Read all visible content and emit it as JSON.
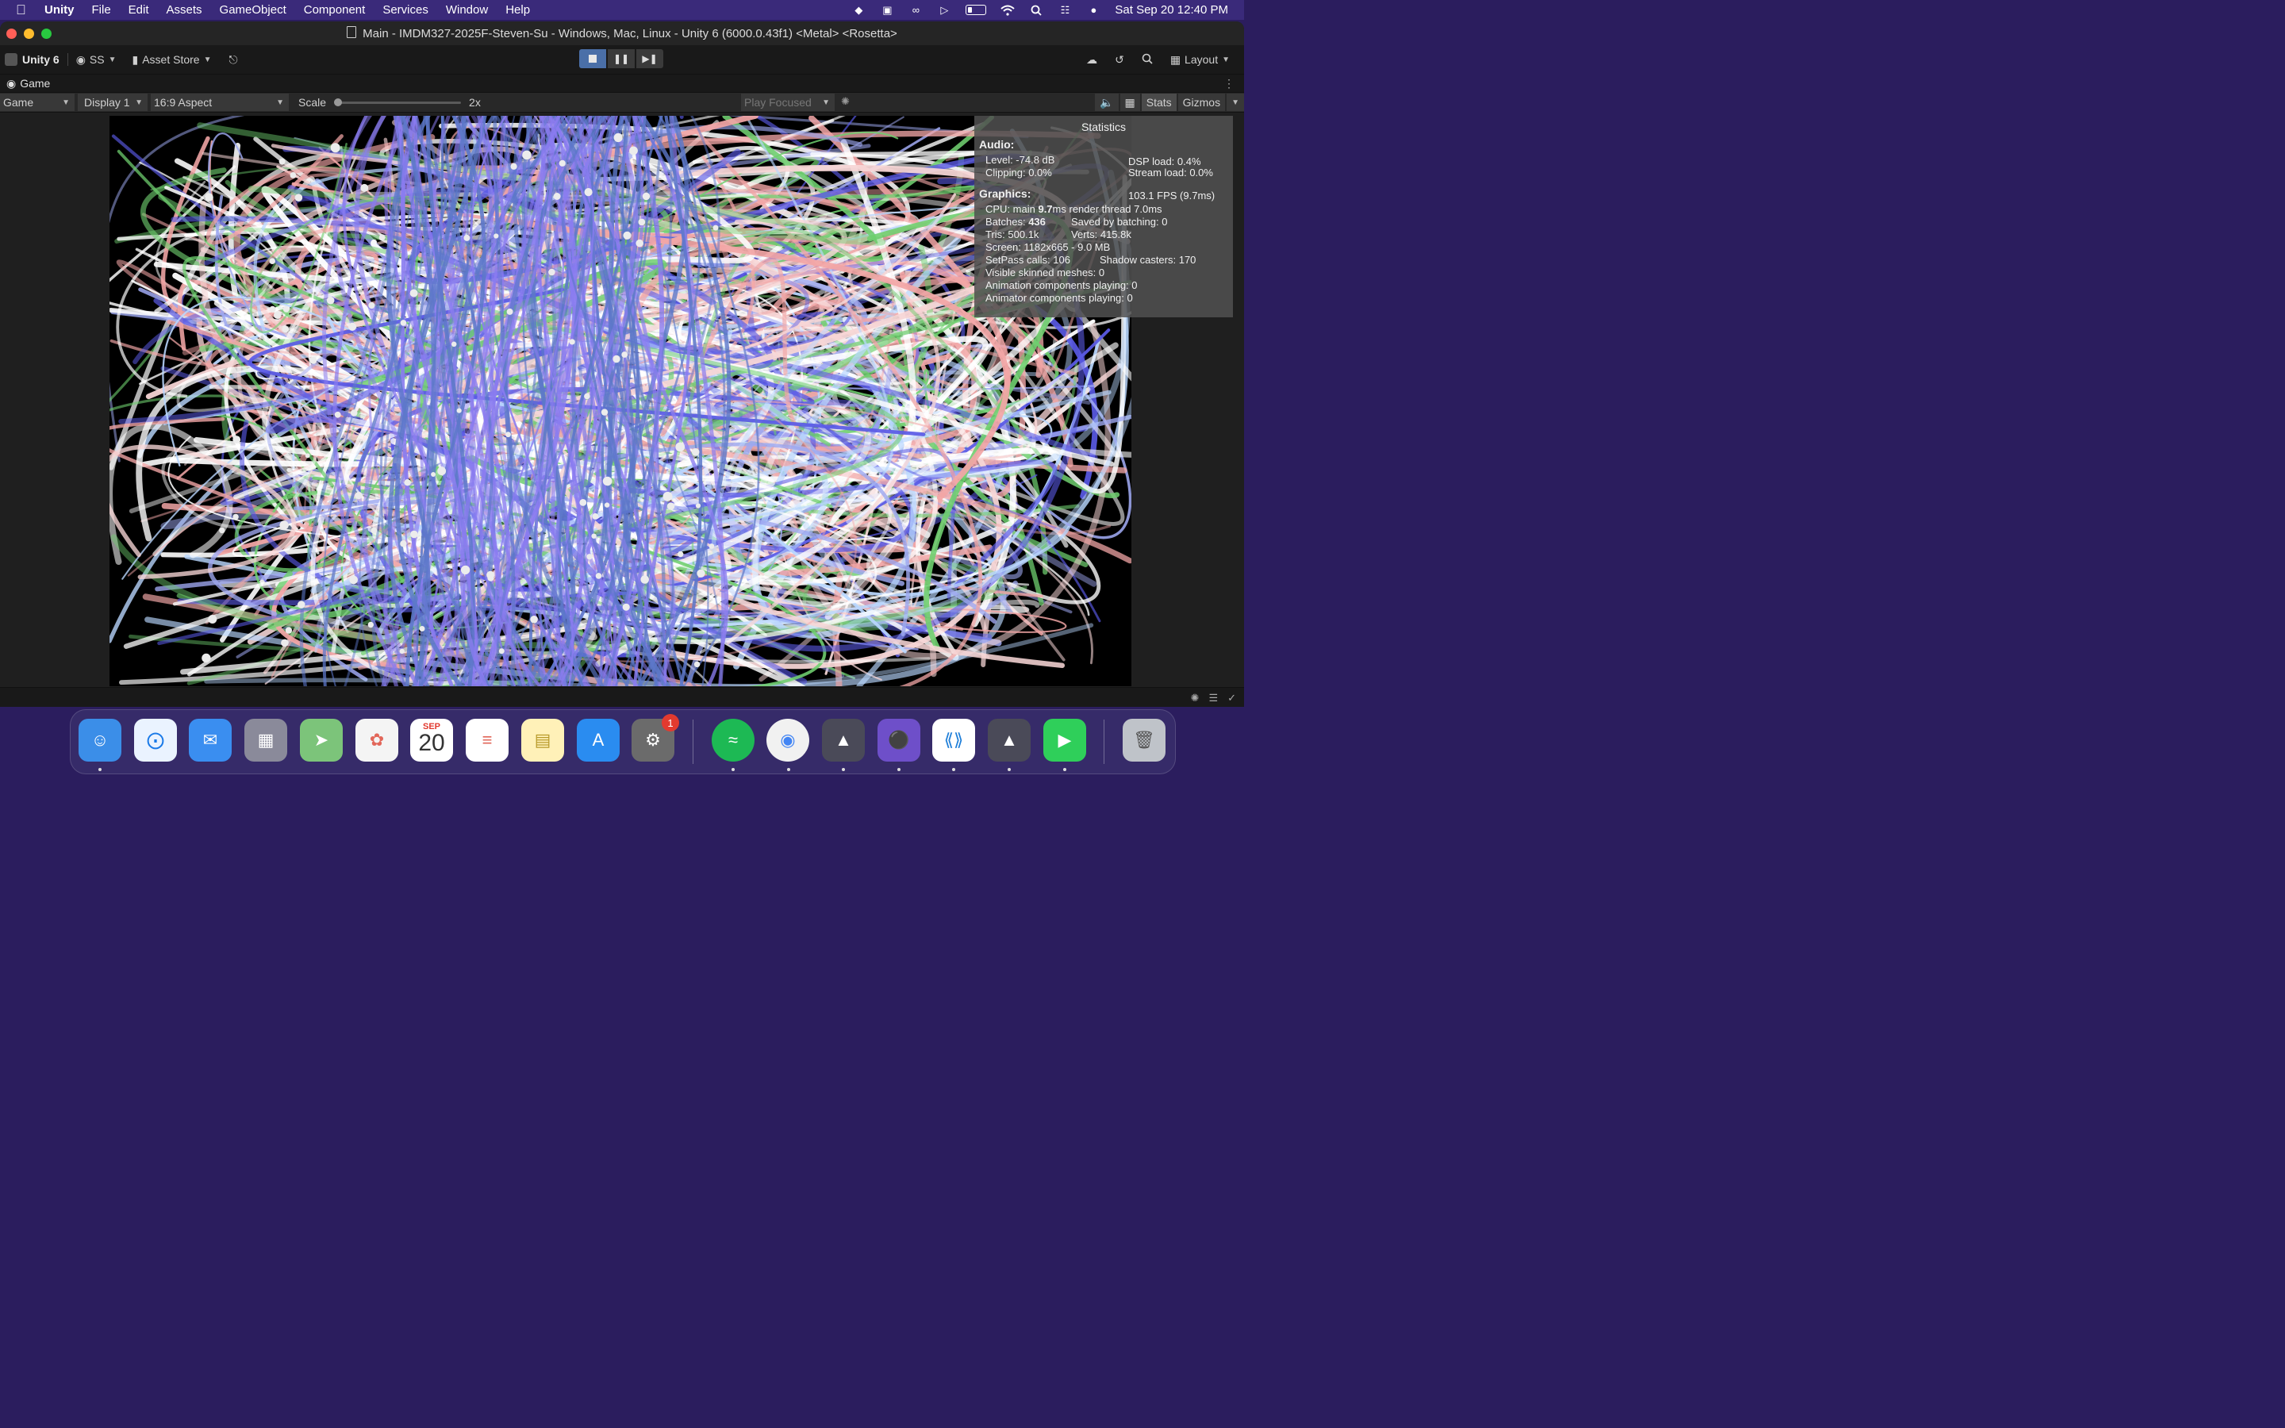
{
  "menubar": {
    "app_name": "Unity",
    "items": [
      "File",
      "Edit",
      "Assets",
      "GameObject",
      "Component",
      "Services",
      "Window",
      "Help"
    ],
    "clock": "Sat Sep 20  12:40 PM"
  },
  "window": {
    "title": "Main - IMDM327-2025F-Steven-Su - Windows, Mac, Linux - Unity 6 (6000.0.43f1) <Metal> <Rosetta>"
  },
  "toolbar": {
    "unity_label": "Unity 6",
    "account_label": "SS",
    "asset_store_label": "Asset Store",
    "layout_label": "Layout"
  },
  "tab": {
    "label": "Game"
  },
  "gamebar": {
    "view_select": "Game",
    "display_select": "Display 1",
    "aspect_select": "16:9 Aspect",
    "scale_label": "Scale",
    "scale_value": "2x",
    "scale_level": 0.0,
    "play_focused": "Play Focused",
    "stats_label": "Stats",
    "gizmos_label": "Gizmos"
  },
  "stats": {
    "title": "Statistics",
    "audio_heading": "Audio:",
    "level": "Level: -74.8 dB",
    "dsp_load": "DSP load: 0.4%",
    "clipping": "Clipping: 0.0%",
    "stream_load": "Stream load: 0.0%",
    "graphics_heading": "Graphics:",
    "fps": "103.1 FPS (9.7ms)",
    "cpu_prefix": "CPU: main ",
    "cpu_main": "9.7",
    "cpu_suffix": "ms  render thread 7.0ms",
    "batches_prefix": "Batches: ",
    "batches": "436",
    "saved_batching": "Saved by batching: 0",
    "tris": "Tris: 500.1k",
    "verts": "Verts: 415.8k",
    "screen": "Screen: 1182x665 - 9.0 MB",
    "setpass": "SetPass calls: 106",
    "shadow_casters": "Shadow casters: 170",
    "skinned": "Visible skinned meshes: 0",
    "animation": "Animation components playing: 0",
    "animator": "Animator components playing: 0"
  },
  "dock": {
    "calendar_month": "SEP",
    "calendar_day": "20",
    "settings_badge": "1",
    "items": [
      "finder",
      "safari",
      "mail",
      "launchpad",
      "maps",
      "photos",
      "calendar",
      "reminders",
      "notes",
      "app-store",
      "system-settings",
      "spotify",
      "chrome",
      "unity-hub",
      "github-desktop",
      "vscode",
      "unity-6",
      "facetime",
      "trash"
    ]
  },
  "colors": {
    "menubar": "#3a2a7a",
    "play_active": "#4a6fa8",
    "scene_white": "#ffffff",
    "scene_blue": "#5a5ae6",
    "scene_pink": "#f2a6a6",
    "scene_green": "#6fcf6f"
  }
}
